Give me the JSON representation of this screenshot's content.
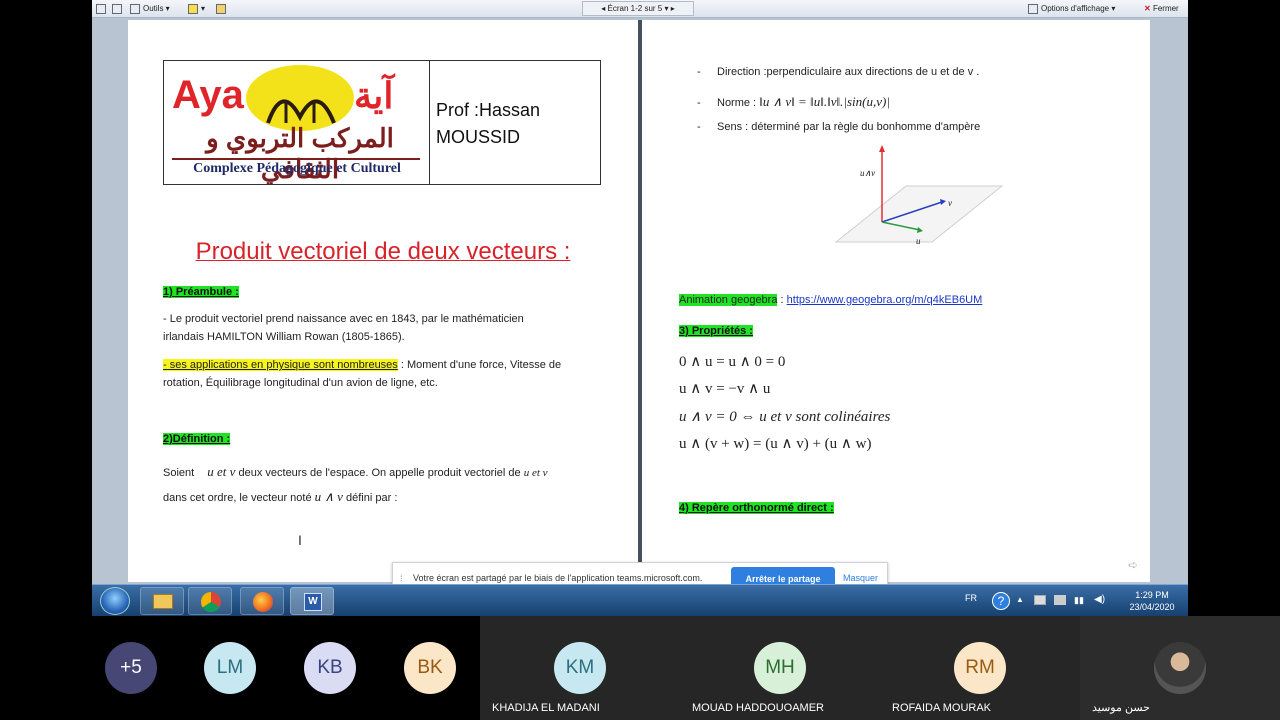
{
  "word_toolbar": {
    "tools_label": "Outils",
    "page_nav": "Écran 1-2 sur 5",
    "view_options": "Options d'affichage",
    "close": "Fermer"
  },
  "left_page": {
    "logo": {
      "aya": "Aya",
      "arabic_title": "آية",
      "arabic_subtitle": "المركب التربوي و الثقافي",
      "french_subtitle": "Complexe Pédagogique et Culturel"
    },
    "prof_line1": "Prof :Hassan",
    "prof_line2": "MOUSSID",
    "title": "Produit vectoriel de deux vecteurs :",
    "section1": "1) Préambule :",
    "para1_line1": "- Le produit vectoriel prend naissance avec en 1843, par le mathématicien",
    "para1_line2": "irlandais HAMILTON William Rowan (1805-1865).",
    "para2_highlight": "- ses applications en physique sont nombreuses",
    "para2_rest": " : Moment d'une force, Vitesse de",
    "para2_line2": "rotation, Équilibrage longitudinal d'un avion de ligne, etc.",
    "section2": "2)Définition :",
    "def_soient": "Soient",
    "def_uv": "u et v",
    "def_rest": " deux vecteurs de l'espace. On appelle produit  vectoriel de ",
    "def_uv_small": "u et v",
    "def_line2": "dans cet ordre, le vecteur noté ",
    "def_cross": "u ∧ v",
    "def_end": "  défini par :"
  },
  "right_page": {
    "direction": "Direction :perpendiculaire aux directions de  u  et de  v .",
    "norme_label": "Norme : ",
    "norme_formula": "‖u ∧ v‖ = ‖u‖.‖v‖.|sin(u,v)|",
    "sens": "Sens : déterminé par la règle du bonhomme d'ampère",
    "fig_labels": {
      "uv": "u∧v",
      "v": "v",
      "u": "u"
    },
    "animation_label": "Animation geogebra",
    "animation_sep": " : ",
    "animation_link": "https://www.geogebra.org/m/q4kEB6UM",
    "section3": "3) Propriétés :",
    "props": [
      "0 ∧ u = u ∧ 0 = 0",
      "u ∧ v = −v ∧ u",
      "u ∧ v = 0  ⇔ u et v sont colinéaires",
      "u ∧ (v + w) = (u ∧ v) + (u ∧ w)"
    ],
    "section4": "4) Repère orthonormé direct :"
  },
  "share_notice": {
    "message": "Votre écran est partagé par le biais de l'application teams.microsoft.com.",
    "stop": "Arrêter le partage",
    "hide": "Masquer"
  },
  "taskbar": {
    "lang": "FR",
    "time": "1:29 PM",
    "date": "23/04/2020"
  },
  "participants": {
    "more": "+5",
    "avatars": [
      {
        "initials": "LM",
        "bg": "#c7e8f0",
        "fg": "#2c6f80"
      },
      {
        "initials": "KB",
        "bg": "#d9dcf2",
        "fg": "#3a4383"
      },
      {
        "initials": "BK",
        "bg": "#fbe6c8",
        "fg": "#9a5a10"
      }
    ],
    "tiles": [
      {
        "initials": "KM",
        "name": "KHADIJA EL MADANI",
        "bg": "#c7e8f0",
        "fg": "#2c6f80"
      },
      {
        "initials": "MH",
        "name": "MOUAD HADDOUOAMER",
        "bg": "#d8efd8",
        "fg": "#2b6e33"
      },
      {
        "initials": "RM",
        "name": "ROFAIDA MOURAK",
        "bg": "#fbe6c8",
        "fg": "#9a5a10"
      },
      {
        "initials": "",
        "name": "حسن موسيد",
        "bg": "#444",
        "fg": "#fff"
      }
    ]
  }
}
